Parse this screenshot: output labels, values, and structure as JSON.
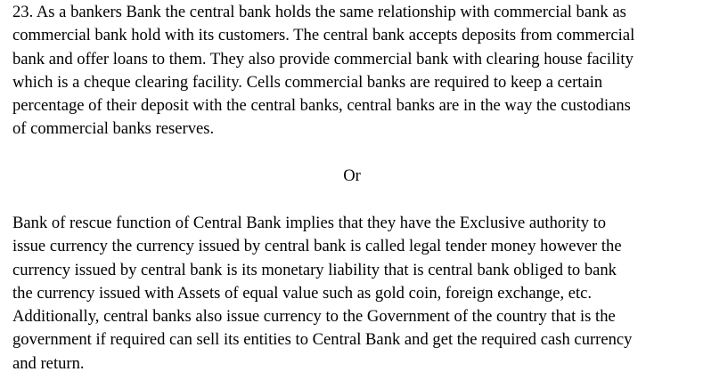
{
  "document": {
    "answer_one": {
      "lines": [
        "23. As a bankers Bank the central bank holds the same relationship with commercial bank as",
        "commercial bank hold with its customers. The central bank accepts deposits from commercial",
        "bank and offer loans to them. They also provide commercial bank with clearing house facility",
        "which is a cheque clearing facility. Cells commercial banks are required to keep a certain",
        "percentage of their deposit with the central banks, central banks are in the way the custodians",
        "of commercial banks reserves."
      ]
    },
    "separator": "Or",
    "answer_two": {
      "lines": [
        "Bank of rescue function of Central Bank implies that they have the Exclusive authority to",
        "issue currency the currency issued by central bank is called legal tender money however the",
        "currency issued by central bank is its monetary liability that is central bank obliged to bank",
        "the currency issued with Assets of equal value such as gold coin, foreign exchange, etc.",
        "Additionally, central banks also issue currency to the Government of the country that is the",
        "government if required can sell its entities to Central Bank and get the required cash currency",
        "and return."
      ]
    }
  }
}
